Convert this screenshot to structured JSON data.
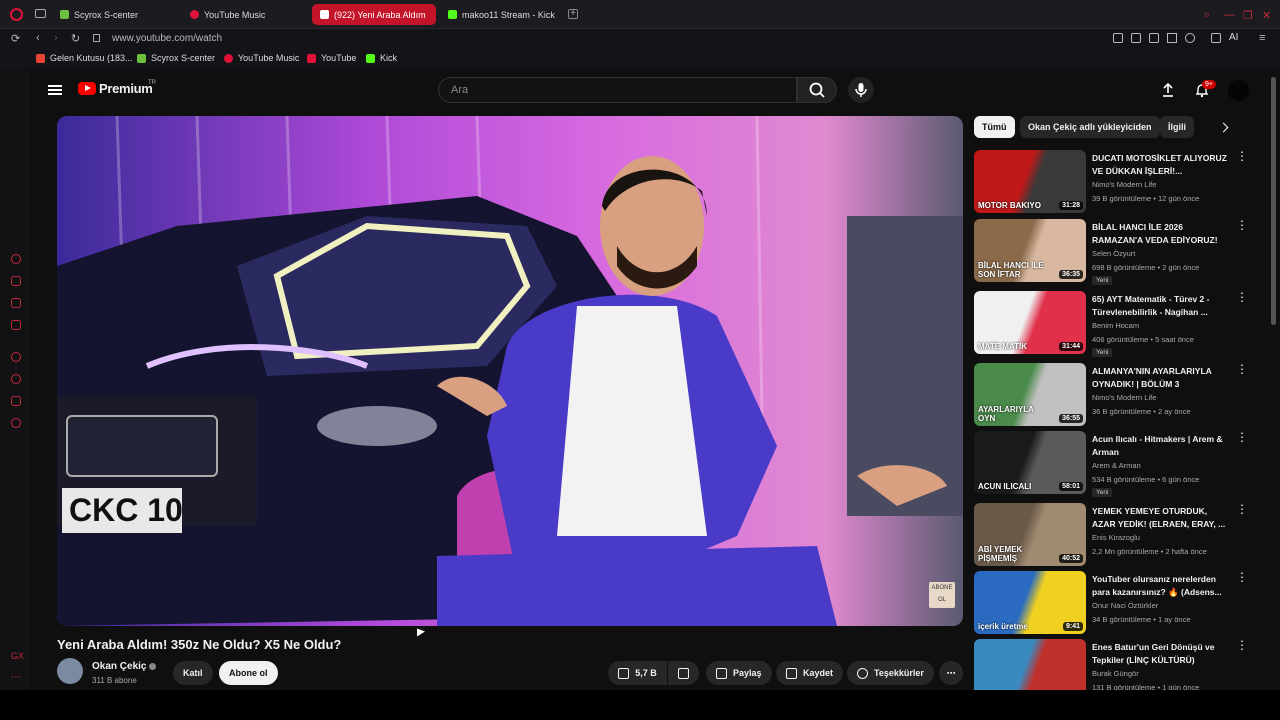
{
  "browser": {
    "tabs": [
      {
        "label": "Scyrox S-center",
        "fav_color": "#6fbf3f"
      },
      {
        "label": "YouTube Music",
        "fav_color": "#e0123a"
      },
      {
        "label": "(922) Yeni Araba Aldım",
        "fav_color": "#ffffff"
      },
      {
        "label": "makoo11 Stream - Kick",
        "fav_color": "#53fc18"
      }
    ],
    "url": "www.youtube.com/watch",
    "ai_label": "AI",
    "bookmarks": [
      {
        "label": "Gelen Kutusu (183...",
        "fav_color": "#ea4335"
      },
      {
        "label": "Scyrox S-center",
        "fav_color": "#6fbf3f"
      },
      {
        "label": "YouTube Music",
        "fav_color": "#e0123a"
      },
      {
        "label": "YouTube",
        "fav_color": "#e0123a"
      },
      {
        "label": "Kick",
        "fav_color": "#53fc18"
      }
    ]
  },
  "header": {
    "logo_text": "Premium",
    "region": "TR",
    "search_placeholder": "Ara",
    "notification_badge": "9+"
  },
  "video": {
    "title": "Yeni Araba Aldım! 350z Ne Oldu? X5 Ne Oldu?",
    "plate": "CKC 10",
    "watermark": "ABONE OL",
    "channel": "Okan Çekiç",
    "subscribers": "311 B abone",
    "join_label": "Katıl",
    "subscribe_label": "Abone ol",
    "likes": "5,7 B",
    "share_label": "Paylaş",
    "save_label": "Kaydet",
    "thanks_label": "Teşekkürler"
  },
  "chips": [
    "Tümü",
    "Okan Çekiç adlı yükleyiciden",
    "İlgili"
  ],
  "recommendations": [
    {
      "title": "DUCATI MOTOSİKLET ALIYORUZ VE DÜKKAN İŞLERİ!...",
      "channel": "Nimo's Modern Life",
      "meta": "39 B görüntüleme • 12 gün önce",
      "duration": "31:28",
      "badge": "",
      "thumb_text": "MOTOR BAKIYO",
      "colors": [
        "#c01818",
        "#3a3a3a"
      ]
    },
    {
      "title": "BİLAL HANCI İLE 2026 RAMAZAN'A VEDA EDİYORUZ!",
      "channel": "Selen Özyurt",
      "meta": "698 B görüntüleme • 2 gün önce",
      "duration": "36:35",
      "badge": "Yeni",
      "thumb_text": "BİLAL HANCI İLE SON İFTAR",
      "colors": [
        "#8a6a4a",
        "#d8b8a0"
      ]
    },
    {
      "title": "65) AYT Matematik - Türev 2 - Türevlenebilirlik - Nagihan ...",
      "channel": "Benim Hocam",
      "meta": "406 görüntüleme • 5 saat önce",
      "duration": "31:44",
      "badge": "Yeni",
      "thumb_text": "MATE MATİK",
      "colors": [
        "#f0f0f0",
        "#e0304a"
      ]
    },
    {
      "title": "ALMANYA'NIN AYARLARIYLA OYNADIK! | BÖLÜM 3",
      "channel": "Nimo's Modern Life",
      "meta": "36 B görüntüleme • 2 ay önce",
      "duration": "36:55",
      "badge": "",
      "thumb_text": "AYARLARIYLA OYN",
      "colors": [
        "#4a8a4a",
        "#c0c0c0"
      ]
    },
    {
      "title": "Acun Ilıcalı - Hitmakers | Arem & Arman",
      "channel": "Arem & Arman",
      "meta": "534 B görüntüleme • 6 gün önce",
      "duration": "58:01",
      "badge": "Yeni",
      "thumb_text": "ACUN ILICALI",
      "colors": [
        "#1a1a1a",
        "#5a5a5a"
      ]
    },
    {
      "title": "YEMEK YEMEYE OTURDUK, AZAR YEDİK! (ELRAEN, ERAY, ...",
      "channel": "Enis Kirazoglu",
      "meta": "2,2 Mn görüntüleme • 2 hafta önce",
      "duration": "40:52",
      "badge": "",
      "thumb_text": "ABİ YEMEK PİŞMEMİŞ",
      "colors": [
        "#6a5a4a",
        "#a08a70"
      ]
    },
    {
      "title": "YouTuber olursanız nerelerden para kazanırsınız? 🔥 (Adsens...",
      "channel": "Onur Naci Öztürkler",
      "meta": "34 B görüntüleme • 1 ay önce",
      "duration": "9:41",
      "badge": "",
      "thumb_text": "içerik üretme",
      "colors": [
        "#2a6ac0",
        "#f0d020"
      ]
    },
    {
      "title": "Enes Batur'un Geri Dönüşü ve Tepkiler (LİNÇ KÜLTÜRÜ)",
      "channel": "Burak Güngör",
      "meta": "131 B görüntüleme • 1 gün önce",
      "duration": "",
      "badge": "",
      "thumb_text": "",
      "colors": [
        "#3a8ac0",
        "#c0302a"
      ]
    }
  ],
  "colors": {
    "accent": "#c4142a",
    "yt_red": "#ff0000",
    "background": "#0f0f0f"
  }
}
